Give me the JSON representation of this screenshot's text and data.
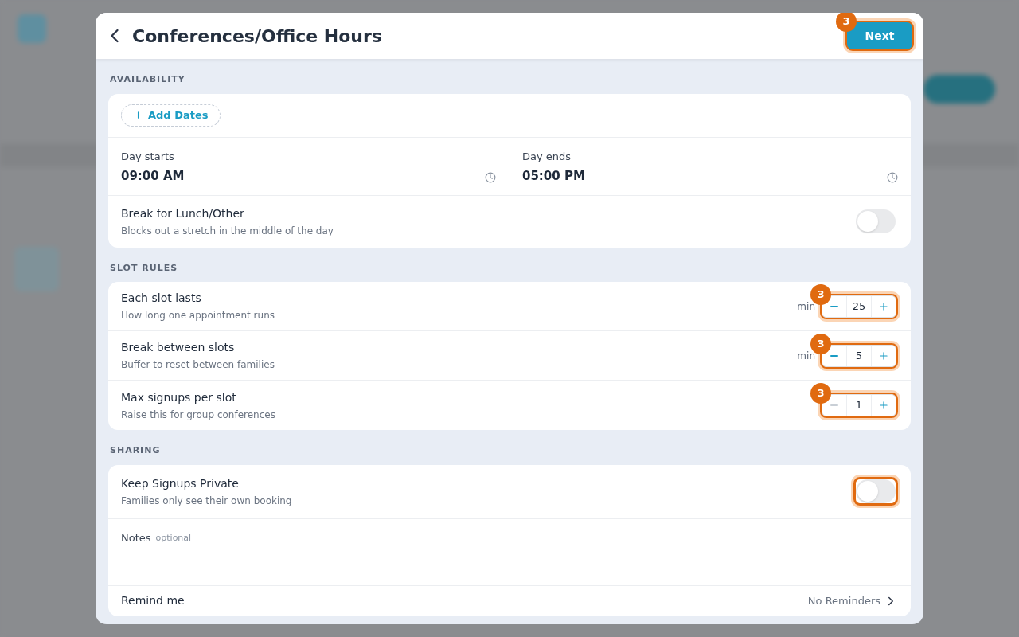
{
  "header": {
    "title": "Conferences/Office Hours",
    "next_button": {
      "label": "Next",
      "highlight": {
        "on": true,
        "badge": "3"
      }
    }
  },
  "availability": {
    "label": "AVAILABILITY",
    "add_dates": "Add Dates",
    "times": [
      {
        "label": "Day starts",
        "value": "09:00 AM"
      },
      {
        "label": "Day ends",
        "value": "05:00 PM"
      }
    ],
    "lunch_break": {
      "title": "Break for Lunch/Other",
      "subtitle": "Blocks out a stretch in the middle of the day",
      "on": false
    }
  },
  "slot_rules": {
    "label": "SLOT RULES",
    "rules": [
      {
        "title": "Each slot lasts",
        "subtitle": "How long one appointment runs",
        "unit": "min",
        "value": "25",
        "minus_disabled": false,
        "highlight": {
          "on": true,
          "badge": "3"
        }
      },
      {
        "title": "Break between slots",
        "subtitle": "Buffer to reset between families",
        "unit": "min",
        "value": "5",
        "minus_disabled": false,
        "highlight": {
          "on": true,
          "badge": "3"
        }
      },
      {
        "title": "Max signups per slot",
        "subtitle": "Raise this for group conferences",
        "value": "1",
        "minus_disabled": true,
        "highlight": {
          "on": true,
          "badge": "3"
        }
      }
    ]
  },
  "sharing": {
    "label": "SHARING",
    "private": {
      "title": "Keep Signups Private",
      "subtitle": "Families only see their own booking",
      "on": false,
      "highlight": {
        "on": true
      }
    },
    "notes": {
      "label": "Notes",
      "hint": "optional"
    },
    "remind": {
      "label": "Remind me",
      "value": "No Reminders"
    }
  }
}
